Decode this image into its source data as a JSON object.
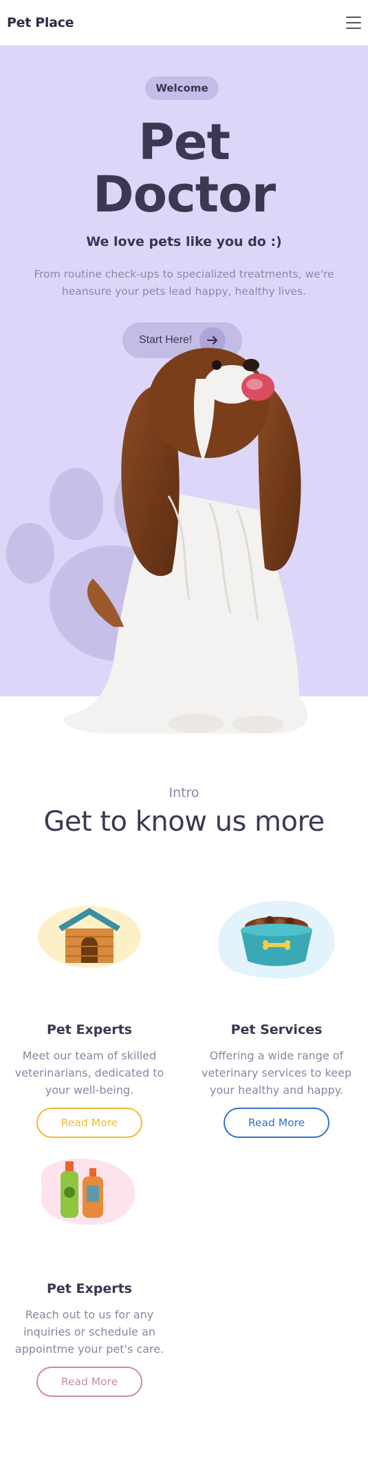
{
  "header": {
    "brand": "Pet Place",
    "menu_icon": "hamburger-icon"
  },
  "hero": {
    "badge": "Welcome",
    "title_line1": "Pet",
    "title_line2": "Doctor",
    "tagline": "We love pets like you do :)",
    "description": "From routine check-ups to specialized treatments, we're heansure your pets lead happy, healthy lives.",
    "cta_label": "Start Here!",
    "cta_icon": "arrow-right-icon",
    "background_color": "#dcd6f8"
  },
  "intro": {
    "kicker": "Intro",
    "title": "Get to know us more"
  },
  "cards": [
    {
      "title": "Pet Experts",
      "text": "Meet our team of skilled veterinarians, dedicated to your well-being.",
      "button": "Read More",
      "accent": "#f5b82e",
      "icon": "dog-house-icon"
    },
    {
      "title": "Pet Services",
      "text": "Offering a wide range of veterinary services to keep your healthy and happy.",
      "button": "Read More",
      "accent": "#2f72c9",
      "icon": "food-bowl-icon"
    },
    {
      "title": "Pet Experts",
      "text": "Reach out to us for any inquiries or schedule an appointme your pet's care.",
      "button": "Read More",
      "accent": "#c98b9c",
      "icon": "pet-shampoo-icon"
    }
  ]
}
